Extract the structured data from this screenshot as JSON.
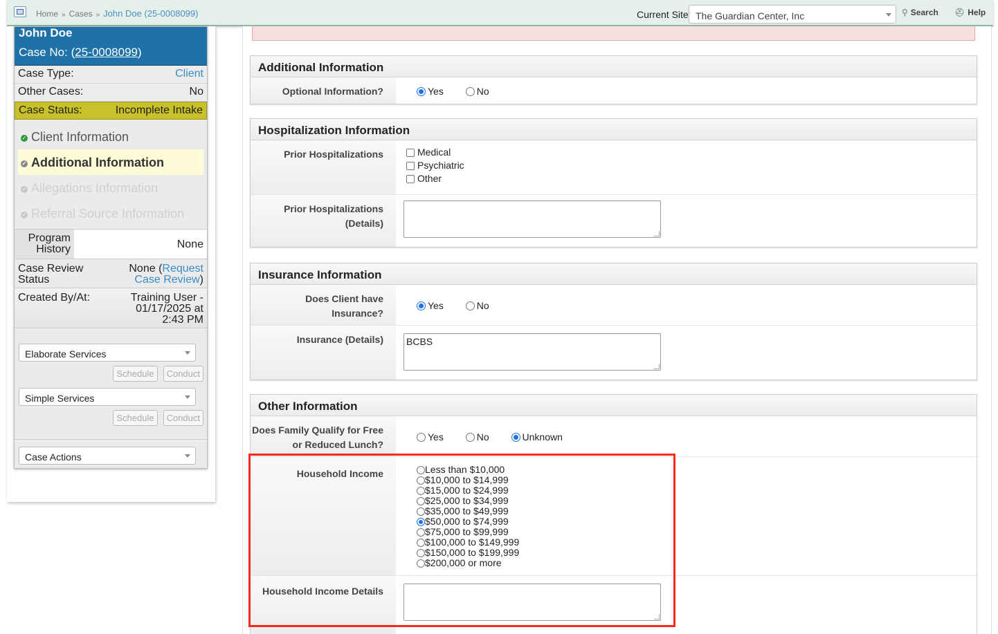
{
  "topbar": {
    "breadcrumb": [
      "Home",
      "Cases"
    ],
    "breadcrumb_current": "John Doe (25-0008099)",
    "current_site_label": "Current Site",
    "current_site_value": "The Guardian Center, Inc",
    "search_label": "Search",
    "help_label": "Help"
  },
  "case": {
    "name": "John Doe",
    "case_no_label": "Case No: (",
    "case_no": "25-0008099",
    "case_no_close": ")",
    "case_type_label": "Case Type:",
    "case_type": "Client",
    "other_cases_label": "Other Cases:",
    "other_cases": "No",
    "status_label": "Case Status:",
    "status": "Incomplete Intake",
    "nav": [
      "Client Information",
      "Additional Information",
      "Allegations Information",
      "Referral Source Information"
    ],
    "program_history_label": "Program History",
    "program_history": "None",
    "review_label": "Case Review Status",
    "review_value": "None (",
    "review_link": "Request Case Review",
    "review_close": ")",
    "created_label": "Created By/At:",
    "created_value": "Training User - 01/17/2025 at 2:43 PM",
    "elaborate_services": "Elaborate Services",
    "simple_services": "Simple Services",
    "case_actions": "Case Actions",
    "schedule_label": "Schedule",
    "conduct_label": "Conduct"
  },
  "sections": {
    "additional": {
      "title": "Additional Information",
      "optional_label": "Optional Information?",
      "yes": "Yes",
      "no": "No",
      "selected": "Yes"
    },
    "hospitalization": {
      "title": "Hospitalization Information",
      "prior_label": "Prior Hospitalizations",
      "options": [
        "Medical",
        "Psychiatric",
        "Other"
      ],
      "details_label": "Prior Hospitalizations (Details)",
      "details_value": ""
    },
    "insurance": {
      "title": "Insurance Information",
      "has_label": "Does Client have Insurance?",
      "yes": "Yes",
      "no": "No",
      "selected": "Yes",
      "details_label": "Insurance (Details)",
      "details_value": "BCBS"
    },
    "other": {
      "title": "Other Information",
      "lunch_label": "Does Family Qualify for Free or Reduced Lunch?",
      "yes": "Yes",
      "no": "No",
      "unknown": "Unknown",
      "lunch_selected": "Unknown",
      "income_label": "Household Income",
      "income_options": [
        "Less than $10,000",
        "$10,000 to $14,999",
        "$15,000 to $24,999",
        "$25,000 to $34,999",
        "$35,000 to $49,999",
        "$50,000 to $74,999",
        "$75,000 to $99,999",
        "$100,000 to $149,999",
        "$150,000 to $199,999",
        "$200,000 or more"
      ],
      "income_selected": "$50,000 to $74,999",
      "income_details_label": "Household Income Details",
      "income_details_value": ""
    }
  },
  "colors": {
    "header_blue": "#1f72a8",
    "status_yellow": "#c8c12a",
    "link_blue": "#3a8cc7",
    "highlight_red": "#ff2a1a"
  }
}
